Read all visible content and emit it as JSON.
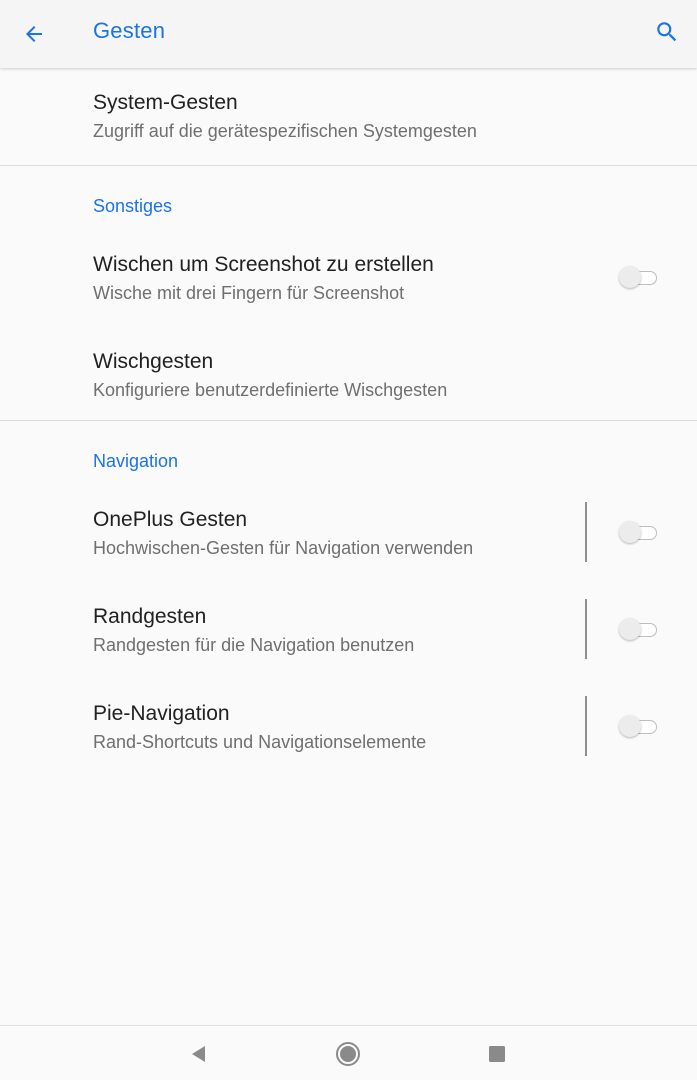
{
  "appbar": {
    "back_icon": "arrow-left-icon",
    "title": "Gesten",
    "search_icon": "search-icon"
  },
  "colors": {
    "accent": "#1a73e8",
    "primary_text": "#212121",
    "secondary_text": "#6f6f6f",
    "background": "#fafafa"
  },
  "items": [
    {
      "title": "System-Gesten",
      "subtitle": "Zugriff auf die gerätespezifischen Systemgesten"
    }
  ],
  "sections": [
    {
      "header": "Sonstiges",
      "items": [
        {
          "title": "Wischen um Screenshot zu erstellen",
          "subtitle": "Wische mit drei Fingern für Screenshot",
          "toggle": "off"
        },
        {
          "title": "Wischgesten",
          "subtitle": "Konfiguriere benutzerdefinierte Wischgesten"
        }
      ]
    },
    {
      "header": "Navigation",
      "items": [
        {
          "title": "OnePlus Gesten",
          "subtitle": "Hochwischen-Gesten für Navigation verwenden",
          "toggle": "off"
        },
        {
          "title": "Randgesten",
          "subtitle": "Randgesten für die Navigation benutzen",
          "toggle": "off"
        },
        {
          "title": "Pie-Navigation",
          "subtitle": "Rand-Shortcuts und Navigationselemente",
          "toggle": "off"
        }
      ]
    }
  ],
  "navbar": {
    "back_icon": "nav-back-triangle-icon",
    "home_icon": "nav-home-circle-icon",
    "recents_icon": "nav-recents-square-icon"
  }
}
